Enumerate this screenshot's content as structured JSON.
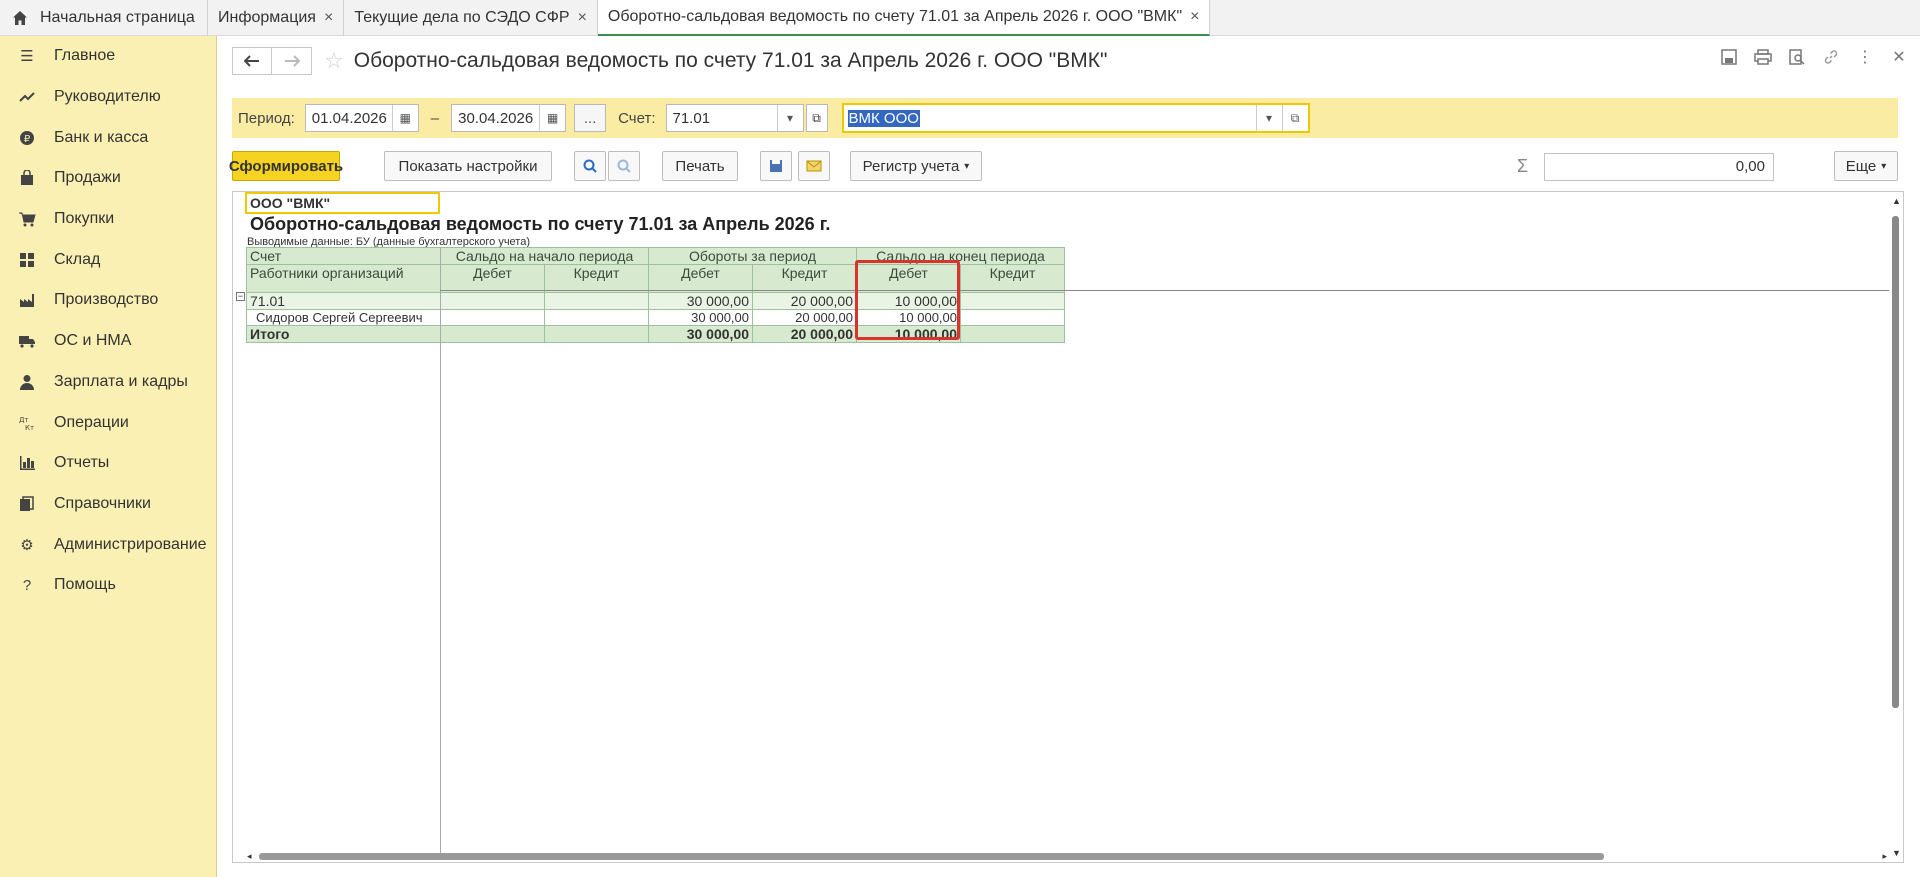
{
  "tabs": [
    {
      "label": "Начальная страница"
    },
    {
      "label": "Информация"
    },
    {
      "label": "Текущие дела по СЭДО СФР"
    },
    {
      "label": "Оборотно-сальдовая ведомость по счету 71.01 за Апрель 2026 г. ООО \"ВМК\""
    }
  ],
  "sidebar": {
    "items": [
      {
        "label": "Главное",
        "icon": "menu-icon"
      },
      {
        "label": "Руководителю",
        "icon": "trend-icon"
      },
      {
        "label": "Банк и касса",
        "icon": "coin-icon"
      },
      {
        "label": "Продажи",
        "icon": "bag-icon"
      },
      {
        "label": "Покупки",
        "icon": "cart-icon"
      },
      {
        "label": "Склад",
        "icon": "warehouse-icon"
      },
      {
        "label": "Производство",
        "icon": "factory-icon"
      },
      {
        "label": "ОС и НМА",
        "icon": "truck-icon"
      },
      {
        "label": "Зарплата и кадры",
        "icon": "person-icon"
      },
      {
        "label": "Операции",
        "icon": "dt-kt-icon"
      },
      {
        "label": "Отчеты",
        "icon": "bar-chart-icon"
      },
      {
        "label": "Справочники",
        "icon": "books-icon"
      },
      {
        "label": "Администрирование",
        "icon": "gear-icon"
      },
      {
        "label": "Помощь",
        "icon": "help-icon"
      }
    ]
  },
  "header": {
    "title": "Оборотно-сальдовая ведомость по счету 71.01 за Апрель 2026 г. ООО \"ВМК\""
  },
  "filter": {
    "period_label": "Период:",
    "date_from": "01.04.2026",
    "dash": "–",
    "date_to": "30.04.2026",
    "dots": "...",
    "account_label": "Счет:",
    "account": "71.01",
    "organization": "ВМК ООО"
  },
  "toolbar": {
    "generate": "Сформировать",
    "show_settings": "Показать настройки",
    "print": "Печать",
    "register": "Регистр учета",
    "sum_value": "0,00",
    "more": "Еще"
  },
  "report": {
    "org": "ООО \"ВМК\"",
    "title": "Оборотно-сальдовая ведомость по счету 71.01 за Апрель 2026 г.",
    "subtitle": "Выводимые данные: БУ (данные бухгалтерского учета)",
    "headers": {
      "account": "Счет",
      "employees": "Работники организаций",
      "opening": "Сальдо на начало периода",
      "turnover": "Обороты за период",
      "closing": "Сальдо на конец периода",
      "debit": "Дебет",
      "credit": "Кредит"
    },
    "rows": [
      {
        "name": "71.01",
        "open_d": "",
        "open_c": "",
        "turn_d": "30 000,00",
        "turn_c": "20 000,00",
        "close_d": "10 000,00",
        "close_c": ""
      },
      {
        "name": "Сидоров Сергей Сергеевич",
        "open_d": "",
        "open_c": "",
        "turn_d": "30 000,00",
        "turn_c": "20 000,00",
        "close_d": "10 000,00",
        "close_c": ""
      },
      {
        "name": "Итого",
        "open_d": "",
        "open_c": "",
        "turn_d": "30 000,00",
        "turn_c": "20 000,00",
        "close_d": "10 000,00",
        "close_c": ""
      }
    ]
  }
}
